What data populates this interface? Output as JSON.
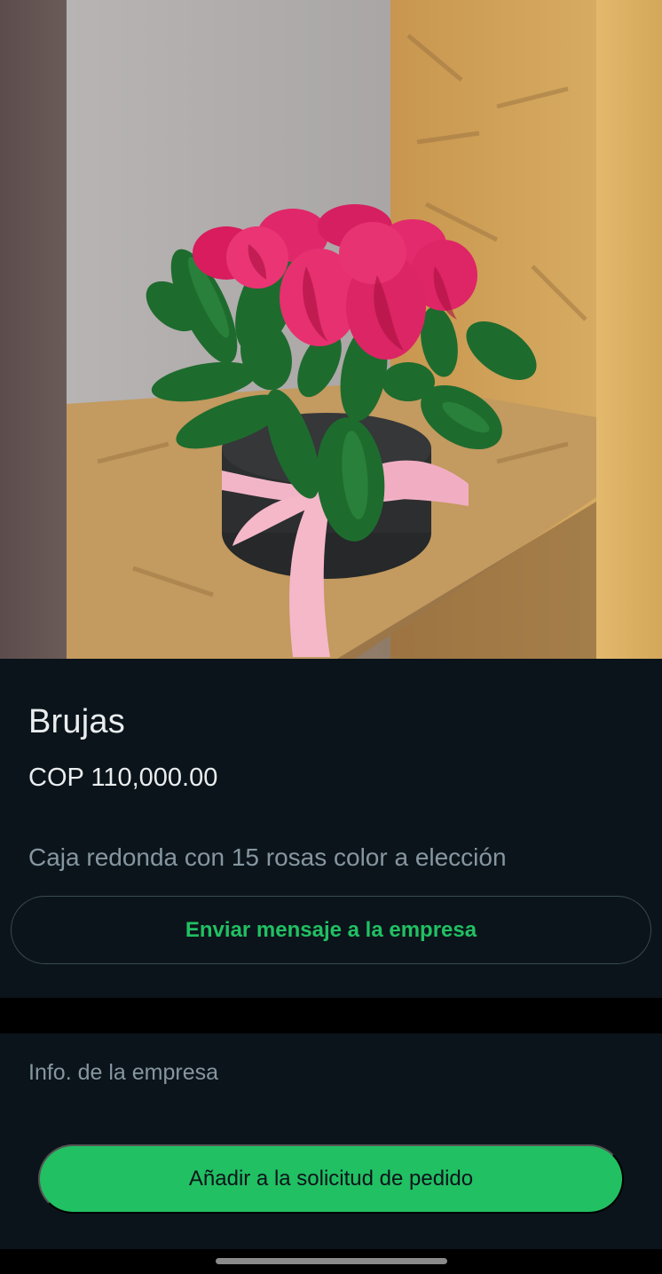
{
  "product": {
    "photo_icon": "product-photo-roses-box",
    "name": "Brujas",
    "price": "COP 110,000.00",
    "description": "Caja redonda con 15 rosas color a elección"
  },
  "actions": {
    "message_label": "Enviar mensaje a la empresa",
    "add_label": "Añadir a la solicitud de pedido"
  },
  "company": {
    "label": "Info. de la empresa"
  },
  "colors": {
    "background": "#0b141a",
    "accent": "#21c063",
    "primary_text": "#e9edef",
    "secondary_text": "#8696a0"
  }
}
